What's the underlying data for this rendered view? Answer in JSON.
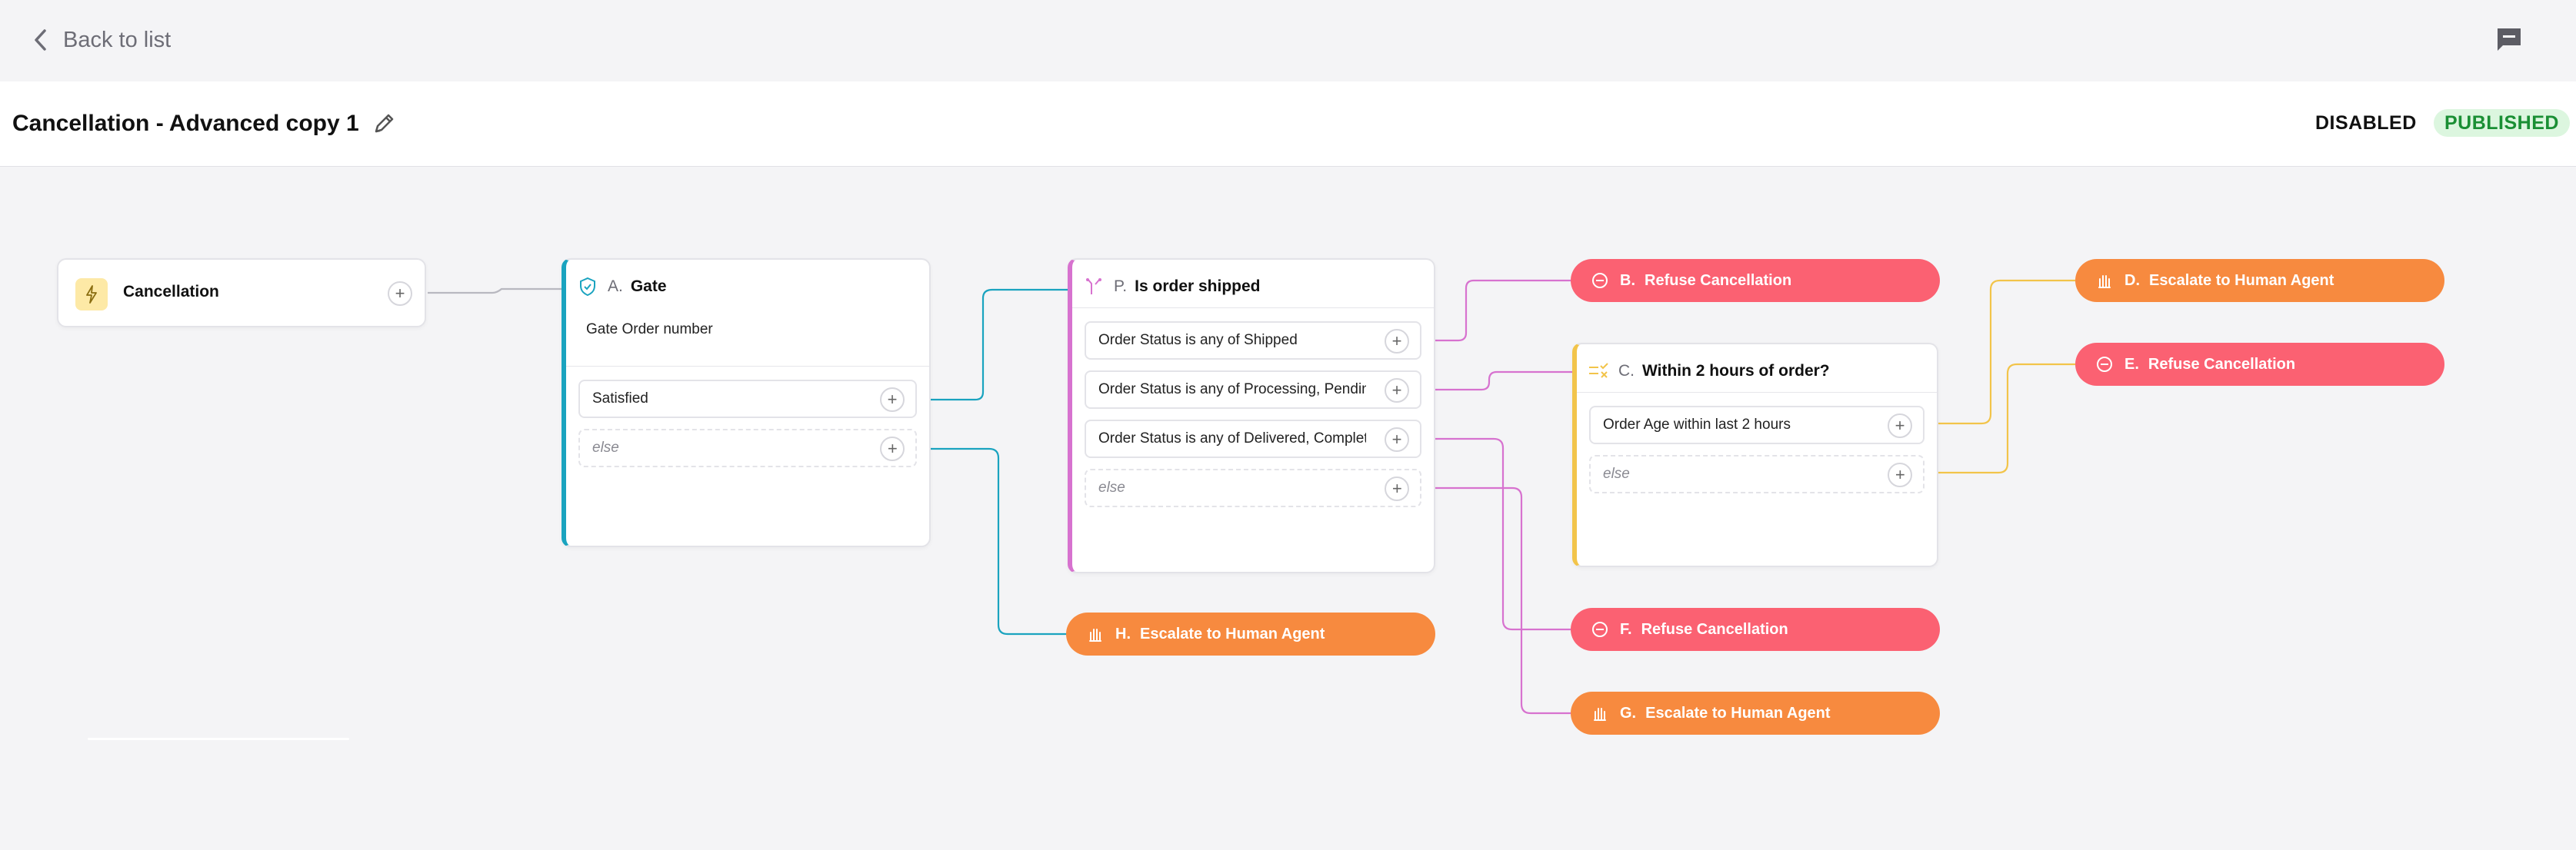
{
  "header": {
    "back_label": "Back to list",
    "title": "Cancellation - Advanced copy 1",
    "status_disabled": "DISABLED",
    "status_published": "PUBLISHED"
  },
  "colors": {
    "teal": "#1aa3bf",
    "pink": "#d772cf",
    "yellow": "#f2c44a",
    "red": "#fb6172",
    "orange": "#f78a3f",
    "published_bg": "#dcf6df",
    "published_fg": "#1a8f34"
  },
  "flow": {
    "trigger": {
      "name": "Cancellation",
      "icon": "lightning-icon"
    },
    "gate": {
      "letter": "A.",
      "name": "Gate",
      "icon": "shield-check-icon",
      "subtitle": "Gate Order number",
      "rows": [
        {
          "label": "Satisfied"
        },
        {
          "label": "else"
        }
      ]
    },
    "shipped": {
      "letter": "P.",
      "name": "Is order shipped",
      "icon": "branch-icon",
      "rows": [
        {
          "label": "Order Status is any of Shipped"
        },
        {
          "label": "Order Status is any of Processing, Pending"
        },
        {
          "label": "Order Status is any of Delivered, Completed"
        },
        {
          "label": "else"
        }
      ]
    },
    "within": {
      "letter": "C.",
      "name": "Within 2 hours of order?",
      "icon": "condition-icon",
      "rows": [
        {
          "label": "Order Age within last 2 hours"
        },
        {
          "label": "else"
        }
      ]
    },
    "actions": {
      "B": {
        "letter": "B.",
        "label": "Refuse Cancellation",
        "icon": "minus-circle-icon"
      },
      "D": {
        "letter": "D.",
        "label": "Escalate to Human Agent",
        "icon": "hand-icon"
      },
      "E": {
        "letter": "E.",
        "label": "Refuse Cancellation",
        "icon": "minus-circle-icon"
      },
      "F": {
        "letter": "F.",
        "label": "Refuse Cancellation",
        "icon": "minus-circle-icon"
      },
      "G": {
        "letter": "G.",
        "label": "Escalate to Human Agent",
        "icon": "hand-icon"
      },
      "H": {
        "letter": "H.",
        "label": "Escalate to Human Agent",
        "icon": "hand-icon"
      }
    }
  }
}
